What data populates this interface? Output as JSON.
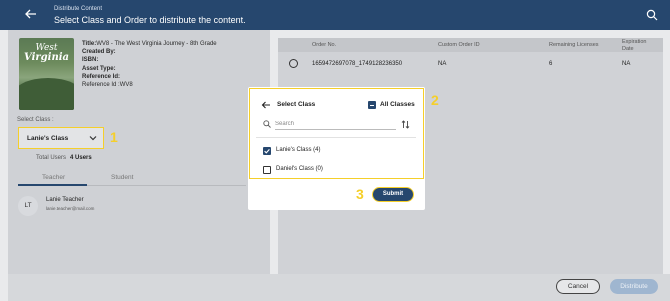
{
  "header": {
    "subtitle": "Distribute Content",
    "title": "Select Class and Order to distribute the content."
  },
  "book": {
    "cover_line1": "West",
    "cover_line2": "Virginia",
    "title_label": "Title:",
    "title_value": "WV8 - The West Virginia Journey - 8th Grade",
    "created_by": "Created By:",
    "isbn": "ISBN:",
    "asset_type": "Asset Type:",
    "reference_id": "Reference Id:",
    "reference_id_line": "Reference Id :WV8"
  },
  "class_select": {
    "label": "Select Class :",
    "value": "Lanie's Class"
  },
  "users": {
    "label": "Total Users",
    "value": "4 Users"
  },
  "tabs": {
    "teacher": "Teacher",
    "student": "Student"
  },
  "teacher": {
    "initials": "LT",
    "name": "Lanie Teacher",
    "email": "lanie.teacher@mail.com"
  },
  "orders_table": {
    "headers": [
      "Order No.",
      "Custom Order ID",
      "Remaining Licenses",
      "Expiration Date"
    ],
    "rows": [
      {
        "order_no": "1659472697078_1749128236350",
        "custom_order_id": "NA",
        "remaining": "6",
        "expiration": "NA"
      }
    ]
  },
  "modal": {
    "title": "Select Class",
    "all_label": "All Classes",
    "search_placeholder": "Search",
    "options": [
      {
        "label": "Lanie's Class (4)",
        "checked": true
      },
      {
        "label": "Daniel's Class (0)",
        "checked": false
      }
    ],
    "submit_label": "Submit"
  },
  "callouts": [
    "1",
    "2",
    "3"
  ],
  "footer": {
    "cancel_label": "Cancel",
    "distribute_label": "Distribute"
  },
  "colors": {
    "navy": "#26476e",
    "highlight": "#f5cf2a"
  }
}
